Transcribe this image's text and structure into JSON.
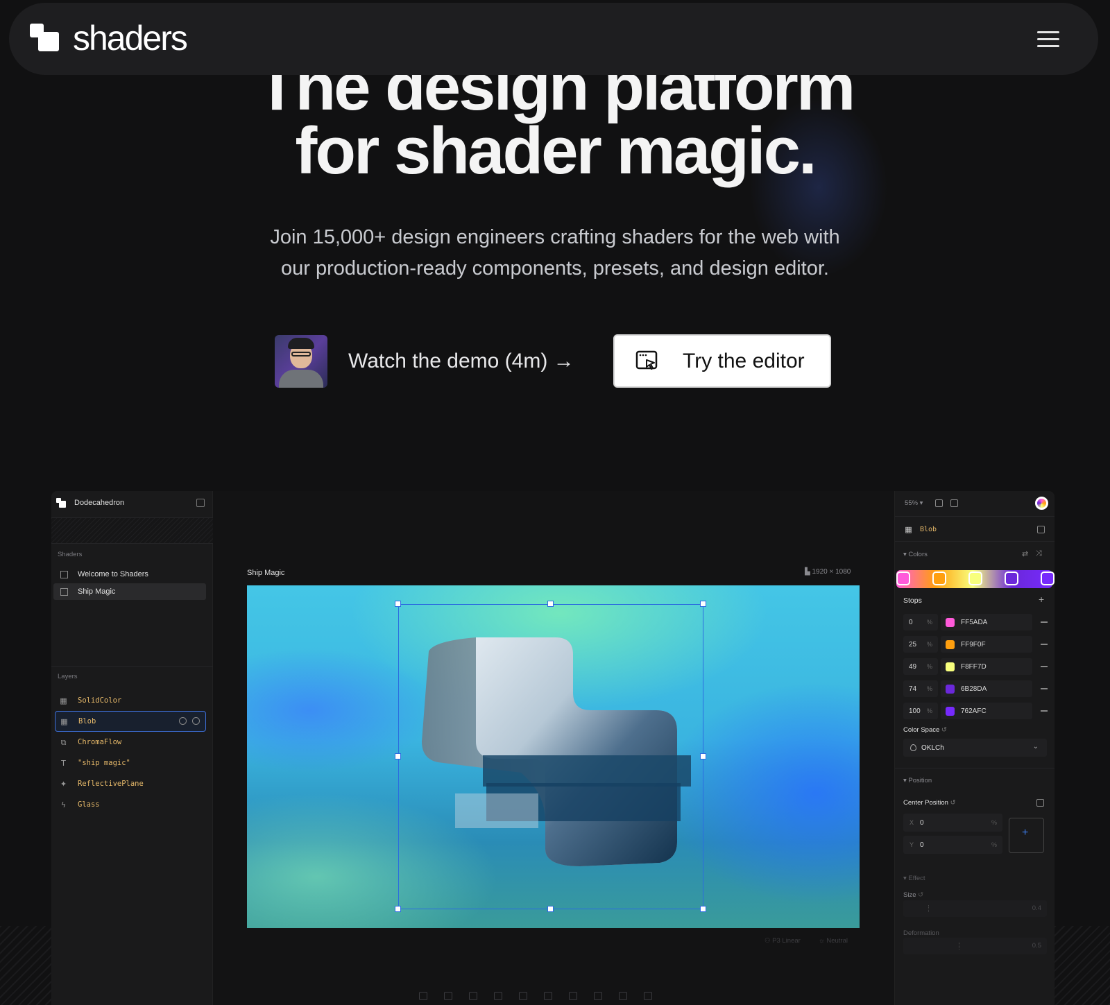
{
  "nav": {
    "logo_text": "shaders",
    "menu_icon": "hamburger-icon"
  },
  "hero": {
    "headline_line1": "The design platform",
    "headline_line2": "for shader magic.",
    "sub_line1": "Join 15,000+ design engineers crafting shaders for the web with",
    "sub_line2": "our production-ready components, presets, and design editor.",
    "demo_label": "Watch the demo (4m) →",
    "try_label": "Try the editor"
  },
  "editor": {
    "project_name": "Dodecahedron",
    "shaders_label": "Shaders",
    "pages": [
      {
        "label": "Welcome to Shaders",
        "active": false
      },
      {
        "label": "Ship Magic",
        "active": true
      }
    ],
    "layers_label": "Layers",
    "layers": [
      {
        "label": "SolidColor",
        "icon": "grid-icon"
      },
      {
        "label": "Blob",
        "icon": "grid-icon",
        "selected": true
      },
      {
        "label": "ChromaFlow",
        "icon": "flow-icon"
      },
      {
        "label": "\"ship magic\"",
        "icon": "text-icon"
      },
      {
        "label": "ReflectivePlane",
        "icon": "sparkle-icon"
      },
      {
        "label": "Glass",
        "icon": "bolt-icon"
      }
    ],
    "frame_label": "Ship Magic",
    "frame_size": "1920 × 1080",
    "canvas_footer": {
      "color_profile": "P3 Linear",
      "tone": "Neutral"
    },
    "right": {
      "zoom": "55%",
      "selected_layer": "Blob",
      "colors_label": "Colors",
      "stops_label": "Stops",
      "stops": [
        {
          "pos": "0",
          "hex": "FF5ADA",
          "color": "#FF5ADA"
        },
        {
          "pos": "25",
          "hex": "FF9F0F",
          "color": "#FF9F0F"
        },
        {
          "pos": "49",
          "hex": "F8FF7D",
          "color": "#F8FF7D"
        },
        {
          "pos": "74",
          "hex": "6B28DA",
          "color": "#6B28DA"
        },
        {
          "pos": "100",
          "hex": "762AFC",
          "color": "#762AFC"
        }
      ],
      "pct_symbol": "%",
      "color_space_label": "Color Space",
      "color_space_value": "OKLCh",
      "position_label": "Position",
      "center_position_label": "Center Position",
      "x_axis": "X",
      "x_value": "0",
      "y_axis": "Y",
      "y_value": "0",
      "effect_label": "Effect",
      "size_label": "Size",
      "size_value": "0.4",
      "deformation_label": "Deformation",
      "deformation_value": "0.5"
    }
  },
  "colors": {
    "accent": "#2B6BE0",
    "layer_text": "#E6B96A",
    "background": "#111112"
  }
}
